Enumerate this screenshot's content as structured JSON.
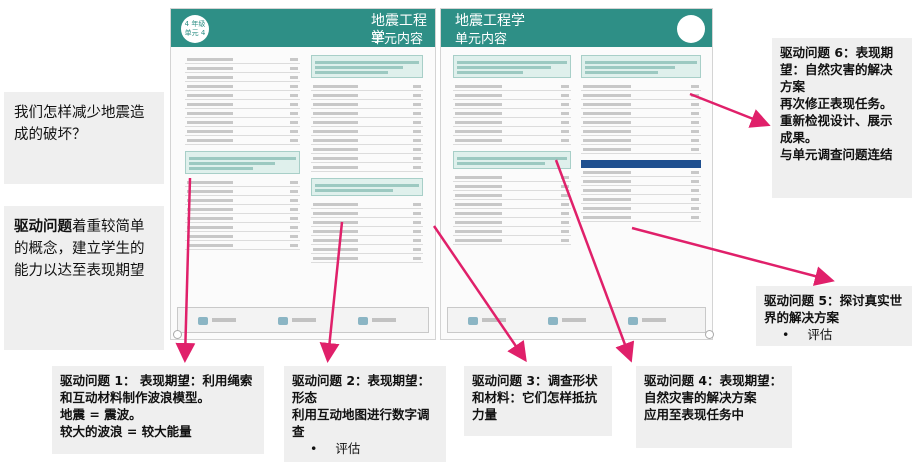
{
  "pages": {
    "left": {
      "title": "地震工程学",
      "badge_top": "4 年级",
      "badge_bottom": "单元 4"
    },
    "right": {
      "title": "地震工程学",
      "subtitle": "单元内容"
    },
    "left_subtitle": "单元内容"
  },
  "callouts": {
    "question": {
      "text": "我们怎样减少地震造成的破坏？"
    },
    "intro": {
      "lead": "驱动问题",
      "text": "着重较简单的概念，建立学生的能力以达至表现期望"
    },
    "q1": {
      "title": "驱动问题 1：",
      "body": " 表现期望：利用绳索和互动材料制作波浪模型。",
      "line2": "地震 = 震波。",
      "line3": "较大的波浪 = 较大能量"
    },
    "q2": {
      "title": "驱动问题 2：表现期望",
      "body": "：形态",
      "line2": "利用互动地图进行数字调查",
      "bullet": "评估"
    },
    "q3": {
      "title": "驱动问题 3：",
      "body": "调查形状和材料：它们怎样抵抗力量"
    },
    "q4": {
      "title": "驱动问题 4：",
      "body": "表现期望：自然灾害的解决方案",
      "line2": "应用至表现任务中"
    },
    "q5": {
      "title": "驱动问题 5：",
      "body": "探讨真实世界的解决方案",
      "bullet": "评估"
    },
    "q6": {
      "title": "驱动问题 6：",
      "body": "表现期望：自然灾害的解决方案",
      "line2": "再次修正表现任务。",
      "line3": "重新检视设计、展示成果。",
      "line4": "与单元调查问题连结"
    }
  },
  "colors": {
    "accent": "#2e8f86",
    "arrow": "#e0206a",
    "callout_bg": "#efefef"
  },
  "icons": [
    "teacher-guide-icon",
    "inquiry-icon",
    "digital-icon"
  ]
}
